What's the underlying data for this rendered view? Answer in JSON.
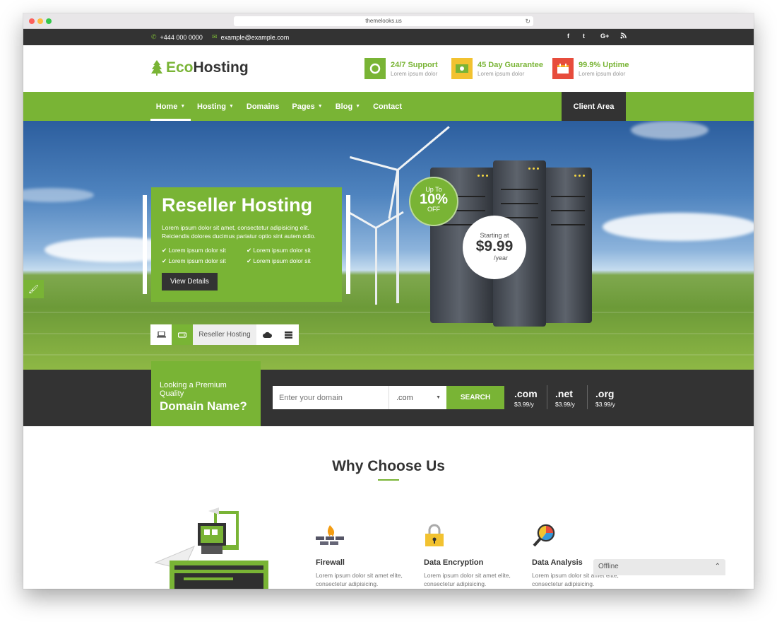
{
  "browser": {
    "url": "themelooks.us"
  },
  "topbar": {
    "phone": "+444 000 0000",
    "email": "example@example.com",
    "social": [
      "f",
      "t",
      "G+",
      "rss"
    ]
  },
  "header": {
    "logo_eco": "Eco",
    "logo_rest": "Hosting",
    "features": [
      {
        "title": "24/7 Support",
        "sub": "Lorem ipsum dolor",
        "icon": "lifebuoy-icon",
        "color": "#79b435"
      },
      {
        "title": "45 Day Guarantee",
        "sub": "Lorem ipsum dolor",
        "icon": "money-icon",
        "color": "#f2c230"
      },
      {
        "title": "99.9% Uptime",
        "sub": "Lorem ipsum dolor",
        "icon": "calendar-icon",
        "color": "#e74c3c"
      }
    ]
  },
  "nav": {
    "items": [
      "Home",
      "Hosting",
      "Domains",
      "Pages",
      "Blog",
      "Contact"
    ],
    "client_area": "Client Area"
  },
  "hero": {
    "title": "Reseller Hosting",
    "desc": "Lorem ipsum dolor sit amet, consectetur adipisicing elit. Reiciendis dolores ducimus pariatur optio sint autem odio.",
    "checks": [
      "Lorem ipsum dolor sit",
      "Lorem ipsum dolor sit",
      "Lorem ipsum dolor sit",
      "Lorem ipsum dolor sit"
    ],
    "button": "View Details",
    "offer_top": "Up To",
    "offer_value": "10%",
    "offer_bottom": "OFF",
    "price_label": "Starting at",
    "price": "$9.99",
    "price_period": "/year",
    "tab_label": "Reseller Hosting"
  },
  "domain": {
    "heading_small": "Looking a Premium Quality",
    "heading_big": "Domain Name?",
    "placeholder": "Enter your domain",
    "tld_selected": ".com",
    "search": "SEARCH",
    "tlds": [
      {
        "name": ".com",
        "price": "$3.99/y"
      },
      {
        "name": ".net",
        "price": "$3.99/y"
      },
      {
        "name": ".org",
        "price": "$3.99/y"
      }
    ]
  },
  "why": {
    "title": "Why Choose Us",
    "features": [
      {
        "title": "Firewall",
        "desc": "Lorem ipsum dolor sit amet elite, consectetur adipisicing."
      },
      {
        "title": "Data Encryption",
        "desc": "Lorem ipsum dolor sit amet elite, consectetur adipisicing."
      },
      {
        "title": "Data Analysis",
        "desc": "Lorem ipsum dolor sit amet elite, consectetur adipisicing."
      }
    ]
  },
  "chat": {
    "status": "Offline"
  },
  "colors": {
    "accent": "#79b435",
    "dark": "#333333"
  }
}
